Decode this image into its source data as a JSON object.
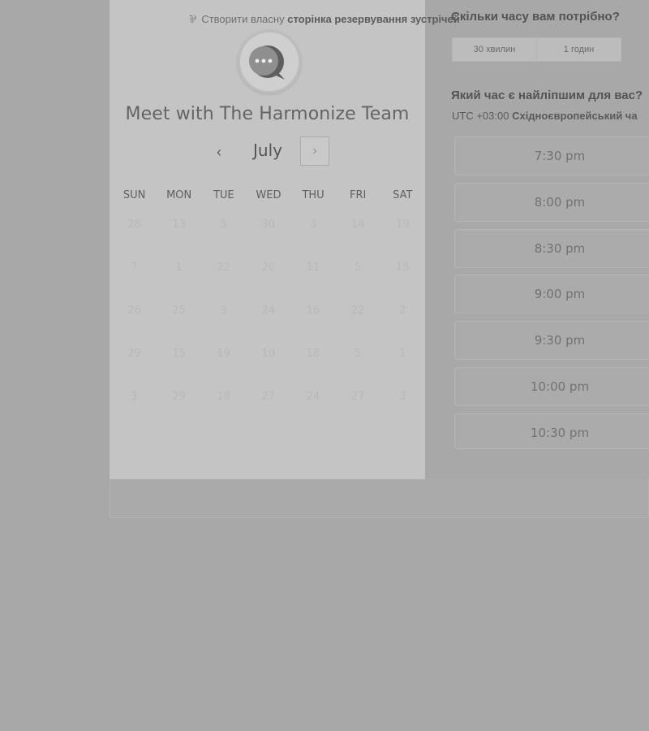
{
  "scheduler": {
    "title": "Meet with The Harmonize Team",
    "month": "July",
    "prev_symbol": "‹",
    "next_symbol": "›",
    "weekdays": [
      "SUN",
      "MON",
      "TUE",
      "WED",
      "THU",
      "FRI",
      "SAT"
    ],
    "weeks": [
      [
        "28",
        "13",
        "5",
        "30",
        "3",
        "14",
        "19"
      ],
      [
        "7",
        "1",
        "22",
        "20",
        "11",
        "5",
        "15"
      ],
      [
        "26",
        "25",
        "3",
        "24",
        "16",
        "22",
        "2"
      ],
      [
        "29",
        "15",
        "19",
        "10",
        "18",
        "5",
        "1"
      ],
      [
        "3",
        "29",
        "18",
        "27",
        "24",
        "27",
        "3"
      ]
    ]
  },
  "duration": {
    "question": "Скільки часу вам потрібно?",
    "options": [
      "30 хвилин",
      "1 годин"
    ]
  },
  "times": {
    "question": "Який час є найліпшим для вас?",
    "tz_offset": "UTC +03:00",
    "tz_name": "Східноєвропейський ча",
    "slots": [
      "7:30 pm",
      "8:00 pm",
      "8:30 pm",
      "9:00 pm",
      "9:30 pm",
      "10:00 pm",
      "10:30 pm"
    ]
  },
  "footer": {
    "icon": "sprocket-icon",
    "text": "Створити власну",
    "bold": "сторінка резервування зустрічей"
  },
  "colors": {
    "overlay_background": "#a8a8a8",
    "panel_background": "#c4c4c4"
  }
}
